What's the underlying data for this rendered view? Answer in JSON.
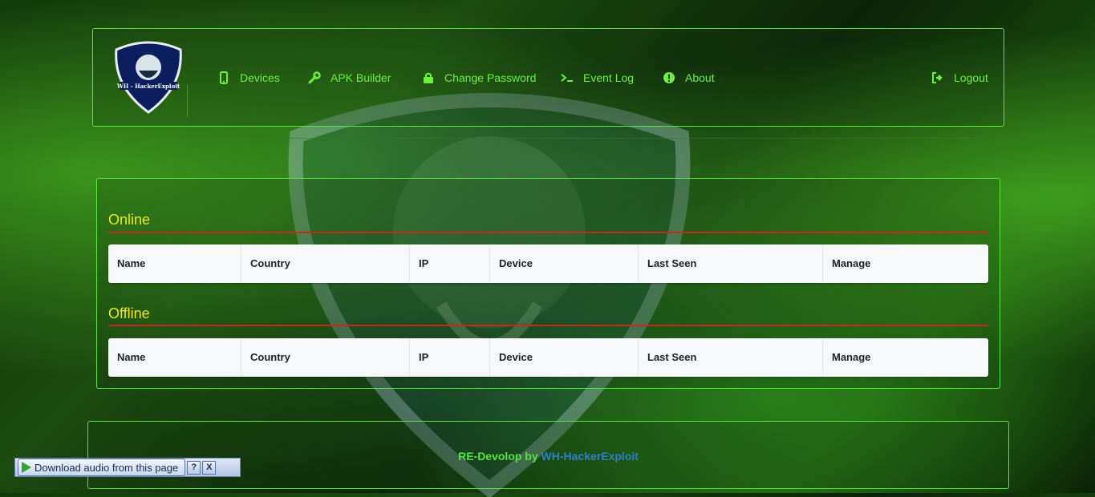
{
  "logo": {
    "text": "WH - HackerExploit"
  },
  "nav": {
    "devices": {
      "label": "Devices",
      "icon": "mobile-icon"
    },
    "apk_builder": {
      "label": "APK Builder",
      "icon": "wrench-icon"
    },
    "change_password": {
      "label": "Change Password",
      "icon": "lock-icon"
    },
    "event_log": {
      "label": "Event Log",
      "icon": "terminal-icon"
    },
    "about": {
      "label": "About",
      "icon": "info-icon"
    },
    "logout": {
      "label": "Logout",
      "icon": "sign-out-icon"
    }
  },
  "online": {
    "title": "Online",
    "columns": [
      "Name",
      "Country",
      "IP",
      "Device",
      "Last Seen",
      "Manage"
    ]
  },
  "offline": {
    "title": "Offline",
    "columns": [
      "Name",
      "Country",
      "IP",
      "Device",
      "Last Seen",
      "Manage"
    ]
  },
  "footer": {
    "text_a": "RE-Devolop by ",
    "text_b": "WH-HackerExploit"
  },
  "download_bar": {
    "label": "Download audio from this page",
    "help": "?",
    "close": "X"
  },
  "colors": {
    "accent": "#6fef3e",
    "title": "#f0e81c",
    "rule": "#c9281c",
    "link": "#2f7fc9"
  }
}
